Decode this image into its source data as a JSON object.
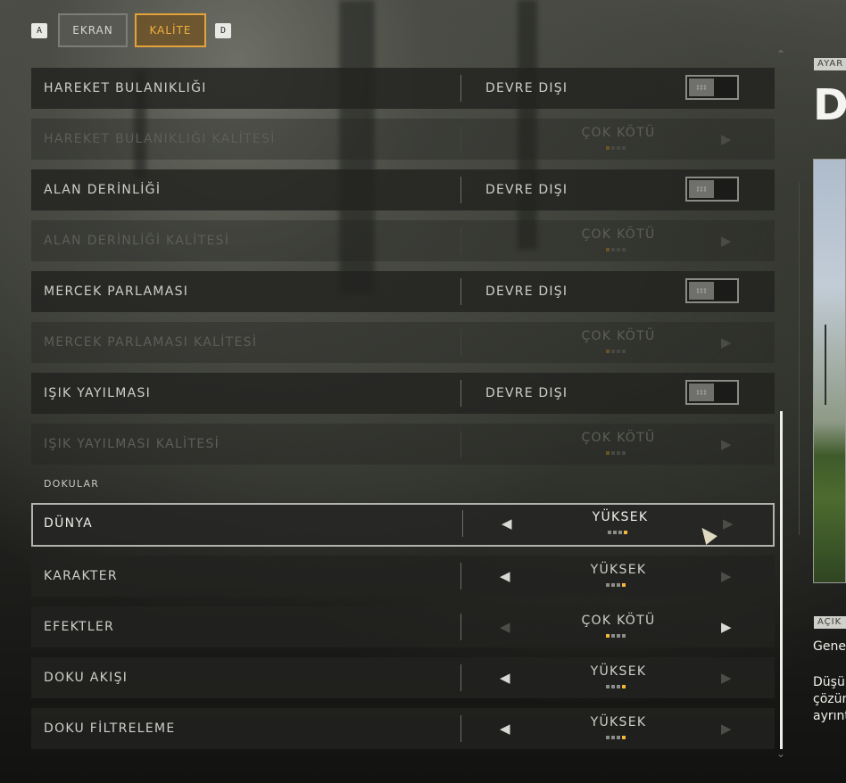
{
  "top_bar": {
    "left_key": "A",
    "right_key": "D",
    "tabs": [
      {
        "label": "EKRAN",
        "active": false
      },
      {
        "label": "KALİTE",
        "active": true
      }
    ]
  },
  "settings": {
    "rows": [
      {
        "label": "HAREKET BULANIKLIĞI",
        "type": "toggle",
        "value": "DEVRE DIŞI",
        "enabled": true
      },
      {
        "label": "HAREKET BULANIKLIĞI KALİTESİ",
        "type": "selector",
        "value": "ÇOK KÖTÜ",
        "level": 1,
        "levels": 4,
        "enabled": false
      },
      {
        "label": "ALAN DERİNLİĞİ",
        "type": "toggle",
        "value": "DEVRE DIŞI",
        "enabled": true
      },
      {
        "label": "ALAN DERİNLİĞİ KALİTESİ",
        "type": "selector",
        "value": "ÇOK KÖTÜ",
        "level": 1,
        "levels": 4,
        "enabled": false
      },
      {
        "label": "MERCEK PARLAMASI",
        "type": "toggle",
        "value": "DEVRE DIŞI",
        "enabled": true
      },
      {
        "label": "MERCEK PARLAMASI KALİTESİ",
        "type": "selector",
        "value": "ÇOK KÖTÜ",
        "level": 1,
        "levels": 4,
        "enabled": false
      },
      {
        "label": "IŞIK YAYILMASI",
        "type": "toggle",
        "value": "DEVRE DIŞI",
        "enabled": true
      },
      {
        "label": "IŞIK YAYILMASI KALİTESİ",
        "type": "selector",
        "value": "ÇOK KÖTÜ",
        "level": 1,
        "levels": 4,
        "enabled": false
      }
    ],
    "section_header": "DOKULAR",
    "texture_rows": [
      {
        "label": "DÜNYA",
        "value": "YÜKSEK",
        "level": 4,
        "levels": 4,
        "selected": true
      },
      {
        "label": "KARAKTER",
        "value": "YÜKSEK",
        "level": 4,
        "levels": 4,
        "selected": false
      },
      {
        "label": "EFEKTLER",
        "value": "ÇOK KÖTÜ",
        "level": 1,
        "levels": 4,
        "selected": false
      },
      {
        "label": "DOKU AKIŞI",
        "value": "YÜKSEK",
        "level": 4,
        "levels": 4,
        "selected": false
      },
      {
        "label": "DOKU FİLTRELEME",
        "value": "YÜKSEK",
        "level": 4,
        "levels": 4,
        "selected": false
      }
    ]
  },
  "right_panel": {
    "badge": "AYAR",
    "title": "D",
    "badge2": "AÇIK",
    "text1": "Gene",
    "text2": "Düşü\nçözün\nayrınt"
  },
  "colors": {
    "accent": "#f2b63a",
    "active_tab_border": "#e3a23a"
  }
}
